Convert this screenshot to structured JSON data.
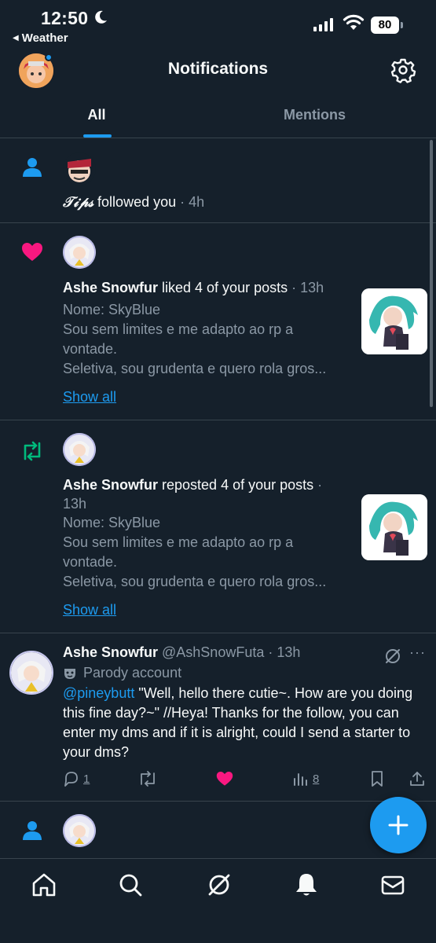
{
  "status_bar": {
    "time": "12:50",
    "back_app": "Weather",
    "battery": "80"
  },
  "header": {
    "title": "Notifications"
  },
  "tabs": [
    {
      "label": "All",
      "active": true
    },
    {
      "label": "Mentions",
      "active": false
    }
  ],
  "notifications": [
    {
      "type": "follow",
      "icon": "person-icon",
      "user": "𝒯𝒾𝓅𝓈",
      "action": " followed you",
      "time": " · 4h"
    },
    {
      "type": "like",
      "icon": "heart-icon",
      "user": "Ashe Snowfur",
      "action": " liked 4 of your posts",
      "time": " · 13h",
      "snippet": [
        "Nome: SkyBlue",
        "Sou sem limites e me adapto ao rp a",
        "vontade.",
        "Seletiva, sou grudenta e quero rola gros..."
      ],
      "show_all": "Show all"
    },
    {
      "type": "repost",
      "icon": "repost-icon",
      "user": "Ashe Snowfur",
      "action": " reposted 4 of your posts",
      "time": " ·",
      "time_line2": "13h",
      "snippet": [
        "Nome: SkyBlue",
        "Sou sem limites e me adapto ao rp a",
        "vontade.",
        "Seletiva, sou grudenta e quero rola gros..."
      ],
      "show_all": "Show all"
    }
  ],
  "tweet": {
    "name": "Ashe Snowfur",
    "handle": " @AshSnowFuta",
    "time": " · 13h",
    "more": "···",
    "parody_label": "Parody account",
    "mention": "@pineybutt",
    "body": " \"Well, hello there cutie~. How are you doing this fine day?~\" //Heya! Thanks for the follow, you can enter my dms and if it is alright, could I send a starter to your dms?",
    "replies": "1",
    "views": "8"
  },
  "colors": {
    "background": "#15202b",
    "accent": "#1d9bf0",
    "like": "#f91880",
    "repost": "#00ba7c",
    "muted": "#8b98a5",
    "divider": "#38444d"
  }
}
